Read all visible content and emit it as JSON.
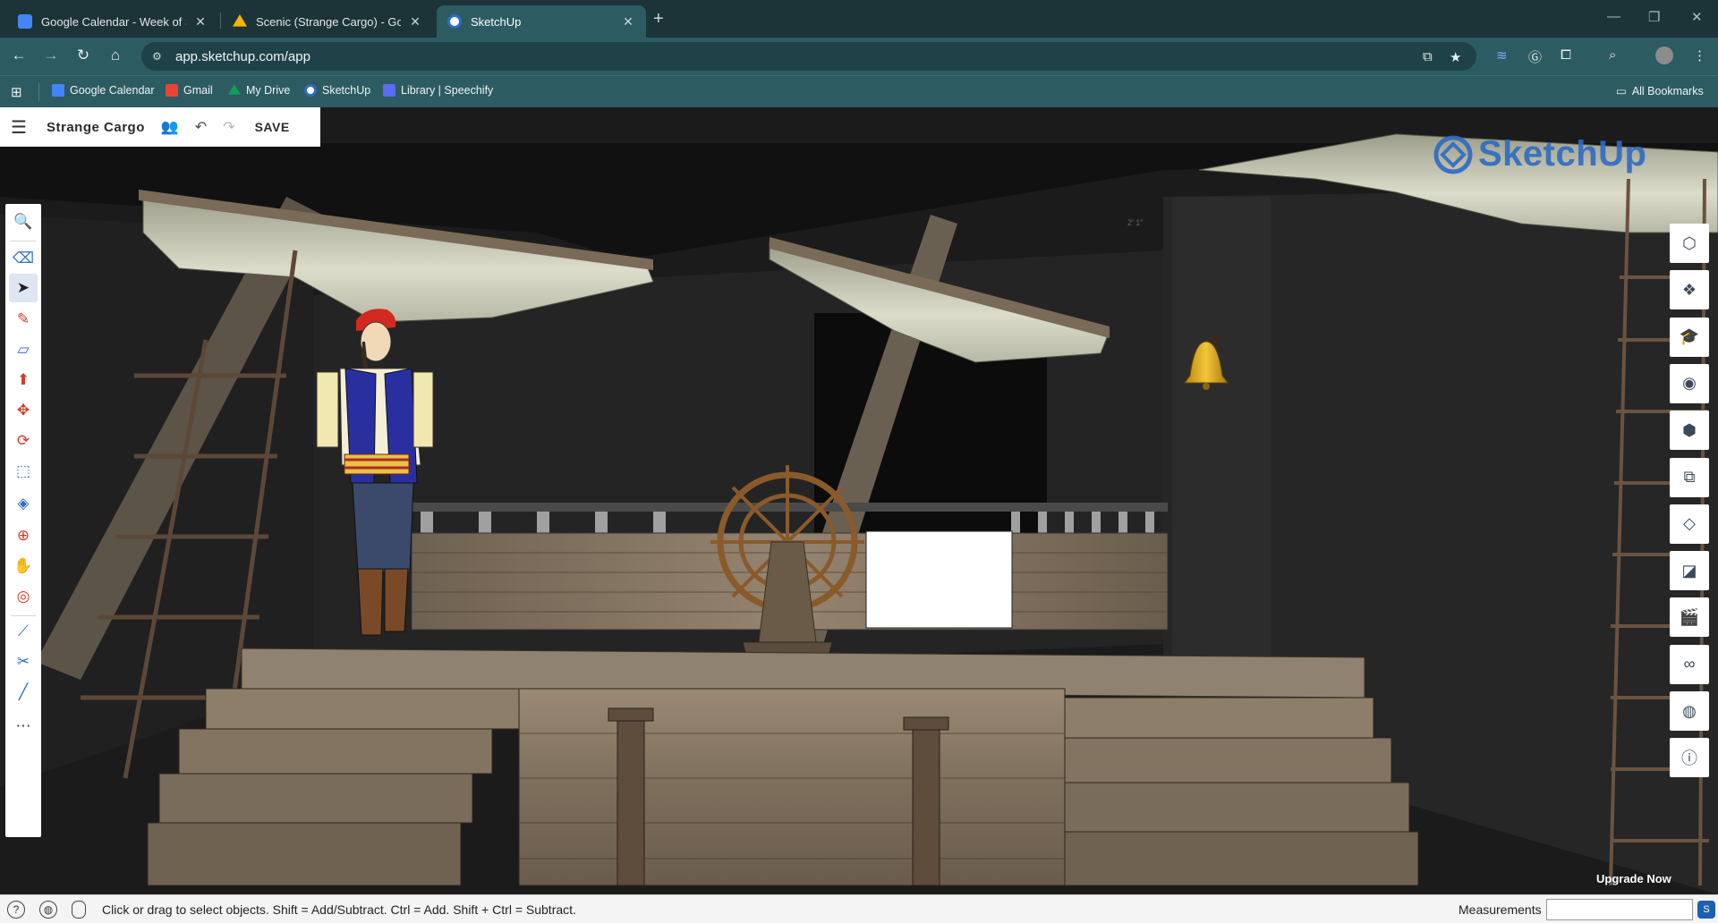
{
  "browser": {
    "tabs": [
      {
        "title": "Google Calendar - Week of Sep",
        "favicon_color": "#4285f4",
        "active": false
      },
      {
        "title": "Scenic (Strange Cargo) - Googl",
        "favicon_color": "#f4b400",
        "active": false
      },
      {
        "title": "SketchUp",
        "favicon_color": "#ffffff",
        "active": true
      }
    ],
    "new_tab": "+",
    "window_controls": {
      "minimize": "—",
      "restore": "❐",
      "close": "✕"
    },
    "url": "app.sketchup.com/app",
    "bookmarks": [
      {
        "label": "Google Calendar",
        "color": "#4285f4"
      },
      {
        "label": "Gmail",
        "color": "#ea4335"
      },
      {
        "label": "My Drive",
        "color": "#0f9d58"
      },
      {
        "label": "SketchUp",
        "color": "#ffffff"
      },
      {
        "label": "Library | Speechify",
        "color": "#5b6cf0"
      }
    ],
    "all_bookmarks": "All Bookmarks"
  },
  "app": {
    "project_name": "Strange Cargo",
    "save_label": "SAVE",
    "logo_text": "SketchUp",
    "upgrade_label": "Upgrade Now",
    "left_tools": [
      {
        "name": "search-tool",
        "icon": "magnifier-icon",
        "glyph": "🔍"
      },
      {
        "name": "eraser-tool",
        "icon": "eraser-icon",
        "glyph": "⌫"
      },
      {
        "name": "select-tool",
        "icon": "arrow-cursor-icon",
        "glyph": "➤"
      },
      {
        "name": "pencil-tool",
        "icon": "pencil-icon",
        "glyph": "✎"
      },
      {
        "name": "rectangle-tool",
        "icon": "rectangle-icon",
        "glyph": "▱"
      },
      {
        "name": "push-pull-tool",
        "icon": "push-pull-icon",
        "glyph": "⬆"
      },
      {
        "name": "move-tool",
        "icon": "move-arrows-icon",
        "glyph": "✥"
      },
      {
        "name": "rotate-tool",
        "icon": "rotate-icon",
        "glyph": "⟳"
      },
      {
        "name": "scale-tool",
        "icon": "scale-icon",
        "glyph": "⬚"
      },
      {
        "name": "paint-bucket-tool",
        "icon": "paint-bucket-icon",
        "glyph": "◈"
      },
      {
        "name": "orbit-tool",
        "icon": "orbit-icon",
        "glyph": "⊕"
      },
      {
        "name": "pan-tool",
        "icon": "hand-icon",
        "glyph": "✋"
      },
      {
        "name": "zoom-extents-tool",
        "icon": "zoom-target-icon",
        "glyph": "◎"
      },
      {
        "name": "tape-measure-tool",
        "icon": "tape-measure-icon",
        "glyph": "⟋"
      },
      {
        "name": "section-plane-tool",
        "icon": "section-plane-icon",
        "glyph": "✂"
      },
      {
        "name": "eyedropper-tool",
        "icon": "eyedropper-icon",
        "glyph": "╱"
      },
      {
        "name": "more-tools",
        "icon": "ellipsis-icon",
        "glyph": "⋯"
      }
    ],
    "right_tools": [
      {
        "name": "entity-info-panel",
        "icon": "cube-outline-icon",
        "glyph": "⬡"
      },
      {
        "name": "components-panel",
        "icon": "components-icon",
        "glyph": "❖"
      },
      {
        "name": "instructor-panel",
        "icon": "graduation-cap-icon",
        "glyph": "🎓"
      },
      {
        "name": "materials-panel",
        "icon": "materials-icon",
        "glyph": "◉"
      },
      {
        "name": "styles-panel",
        "icon": "styles-cube-icon",
        "glyph": "⬢"
      },
      {
        "name": "outliner-panel",
        "icon": "outliner-icon",
        "glyph": "⧉"
      },
      {
        "name": "tags-panel",
        "icon": "tag-icon",
        "glyph": "◇"
      },
      {
        "name": "soften-edges-panel",
        "icon": "eraser-soft-icon",
        "glyph": "◪"
      },
      {
        "name": "scenes-panel",
        "icon": "clapper-icon",
        "glyph": "🎬"
      },
      {
        "name": "display-panel",
        "icon": "glasses-icon",
        "glyph": "∞"
      },
      {
        "name": "shadows-panel",
        "icon": "globe-icon",
        "glyph": "◍"
      },
      {
        "name": "model-info-panel",
        "icon": "info-icon",
        "glyph": "ⓘ"
      }
    ]
  },
  "status": {
    "text": "Click or drag to select objects. Shift = Add/Subtract. Ctrl = Add. Shift + Ctrl = Subtract.",
    "measurements_label": "Measurements",
    "measurements_value": ""
  },
  "scene_colors": {
    "background": "#1b1b1b",
    "wall": "#262626",
    "wood": "#8a7a66",
    "wood_dark": "#5e5244",
    "sail": "#cfd2c3",
    "bell": "#d9a520",
    "vest": "#2a2fa0",
    "bandana": "#d22a1e"
  }
}
